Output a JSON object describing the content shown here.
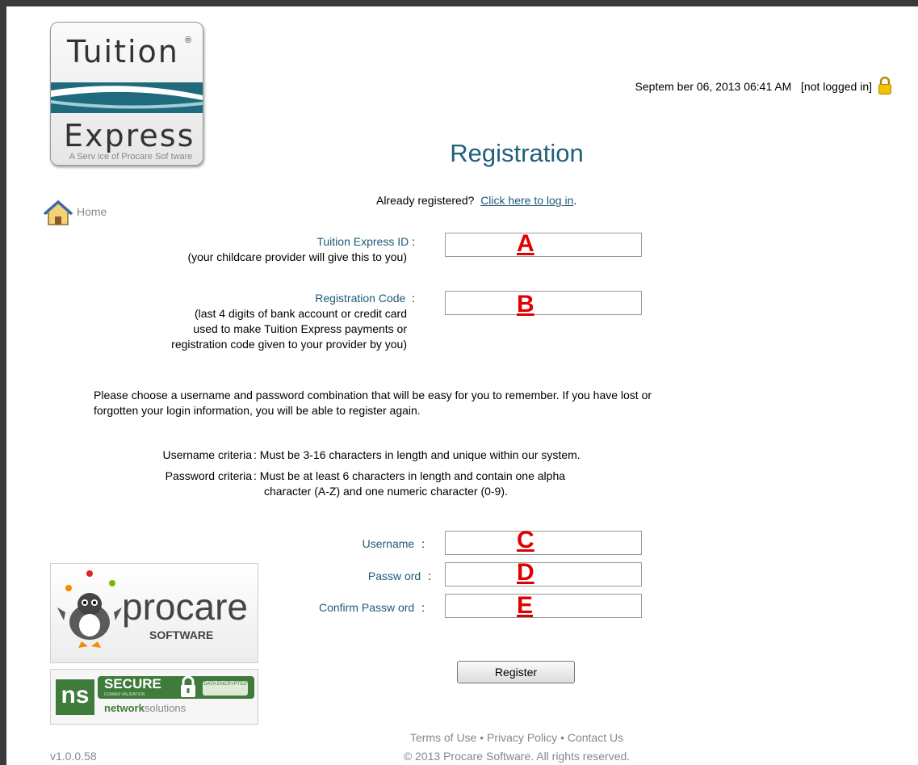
{
  "header": {
    "logo_line1": "Tuition",
    "logo_reg": "®",
    "logo_line2": "Express",
    "tagline": "A Serv ice of Procare Sof tware",
    "datetime": "Septem ber 06, 2013 06:41 AM",
    "login_status": "[not logged in]"
  },
  "nav": {
    "home_label": "Home"
  },
  "page": {
    "title": "Registration",
    "already_text": "Already registered?",
    "login_link": "Click here to log in",
    "login_period": "."
  },
  "fields": {
    "tuition_id_label": "Tuition Express ID",
    "tuition_id_hint": "(your childcare provider will give this to you)",
    "reg_code_label": "Registration Code",
    "reg_code_hint1": "(last 4 digits of bank account or credit card",
    "reg_code_hint2": "used to make Tuition Express payments or",
    "reg_code_hint3": "registration code given to your provider by you)",
    "colon": ":",
    "username_label": "Username",
    "password_label": "Passw ord",
    "confirm_label": "Confirm Passw ord"
  },
  "markers": {
    "a": "A",
    "b": "B",
    "c": "C",
    "d": "D",
    "e": "E"
  },
  "instructions": {
    "line1": "Please choose a username and password combination that will be easy for you to remember.  If you have lost or",
    "line2": "forgotten your login information,  you will be able to register again.",
    "username_criteria_label": "Username criteria",
    "username_criteria": ": Must be 3-16 characters  in length and unique within our system.",
    "password_criteria_label": "Password criteria",
    "password_criteria1": ": Must be at least 6 characters  in length and contain one alpha",
    "password_criteria2": "character (A-Z) and one numeric character (0-9)."
  },
  "actions": {
    "register_label": "Register"
  },
  "badges": {
    "procare_word": "procare",
    "procare_software": "SOFTWARE",
    "secure_ns": "ns",
    "secure_word": "SECURE",
    "secure_validation": "DOMAIN VALIDATION",
    "secure_data": "DATA ENCRYPTED",
    "secure_network": "network",
    "secure_solutions": "solutions"
  },
  "footer": {
    "terms": "Terms of Use",
    "privacy": "Privacy Policy",
    "contact": "Contact Us",
    "bullet": "•",
    "copyright": "© 2013 Procare Software. All rights reserved.",
    "version": "v1.0.0.58"
  },
  "colors": {
    "accent": "#1e5a78",
    "marker": "#e00000",
    "logo_band": "#1f6b7c"
  }
}
